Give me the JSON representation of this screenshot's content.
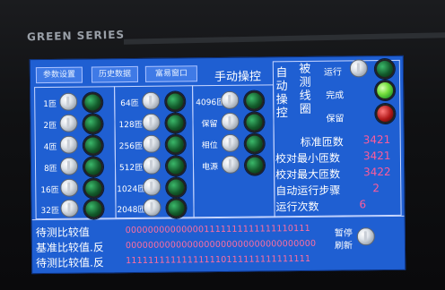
{
  "device": {
    "brand": "GREEN SERIES"
  },
  "top_buttons": [
    "参数设置",
    "历史数据",
    "富易窗口"
  ],
  "title": "手动操控",
  "scale_buttons": [
    "1匝",
    "2匝",
    "4匝",
    "8匝",
    "16匝",
    "32匝"
  ],
  "scale_buttons_col2": [
    "64匝",
    "128匝",
    "256匝",
    "512匝",
    "1024匝",
    "2048匝"
  ],
  "mid_buttons": [
    "4096匝",
    "保留",
    "相位",
    "电源"
  ],
  "auto_label": [
    "自",
    "动",
    "操",
    "控"
  ],
  "coil_label": [
    "被",
    "测",
    "线",
    "圈"
  ],
  "status": {
    "run": "运行",
    "done": "完成",
    "reserve": "保留"
  },
  "stats": [
    {
      "label": "标准匝数",
      "value": "3421"
    },
    {
      "label": "校对最小匝数",
      "value": "3421"
    },
    {
      "label": "校对最大匝数",
      "value": "3422"
    },
    {
      "label": "自动运行步骤",
      "value": "2"
    },
    {
      "label": "运行次数",
      "value": "6"
    }
  ],
  "compare": [
    {
      "label": "待测比较值",
      "value": "000000000000001111111111111110111"
    },
    {
      "label": "基准比较值.反",
      "value": "0000000000000000000000000000000000"
    },
    {
      "label": "待测比较值.反",
      "value": "111111111111111110111111111111111"
    }
  ],
  "pause_button": [
    "暂停",
    "刷新"
  ]
}
